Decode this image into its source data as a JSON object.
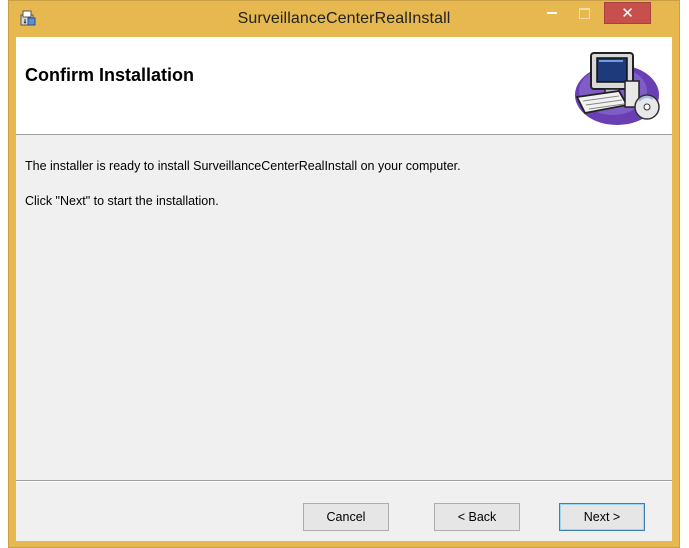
{
  "window": {
    "title": "SurveillanceCenterRealInstall",
    "close_glyph": "✕",
    "titlebar_color": "#e6b84f",
    "close_color": "#c7504c"
  },
  "banner": {
    "title": "Confirm Installation",
    "graphic": "computer-installer-icon"
  },
  "body": {
    "line1": "The installer is ready to install SurveillanceCenterRealInstall on your computer.",
    "line2": "Click \"Next\" to start the installation."
  },
  "buttons": {
    "cancel": "Cancel",
    "back": "< Back",
    "next": "Next >"
  }
}
